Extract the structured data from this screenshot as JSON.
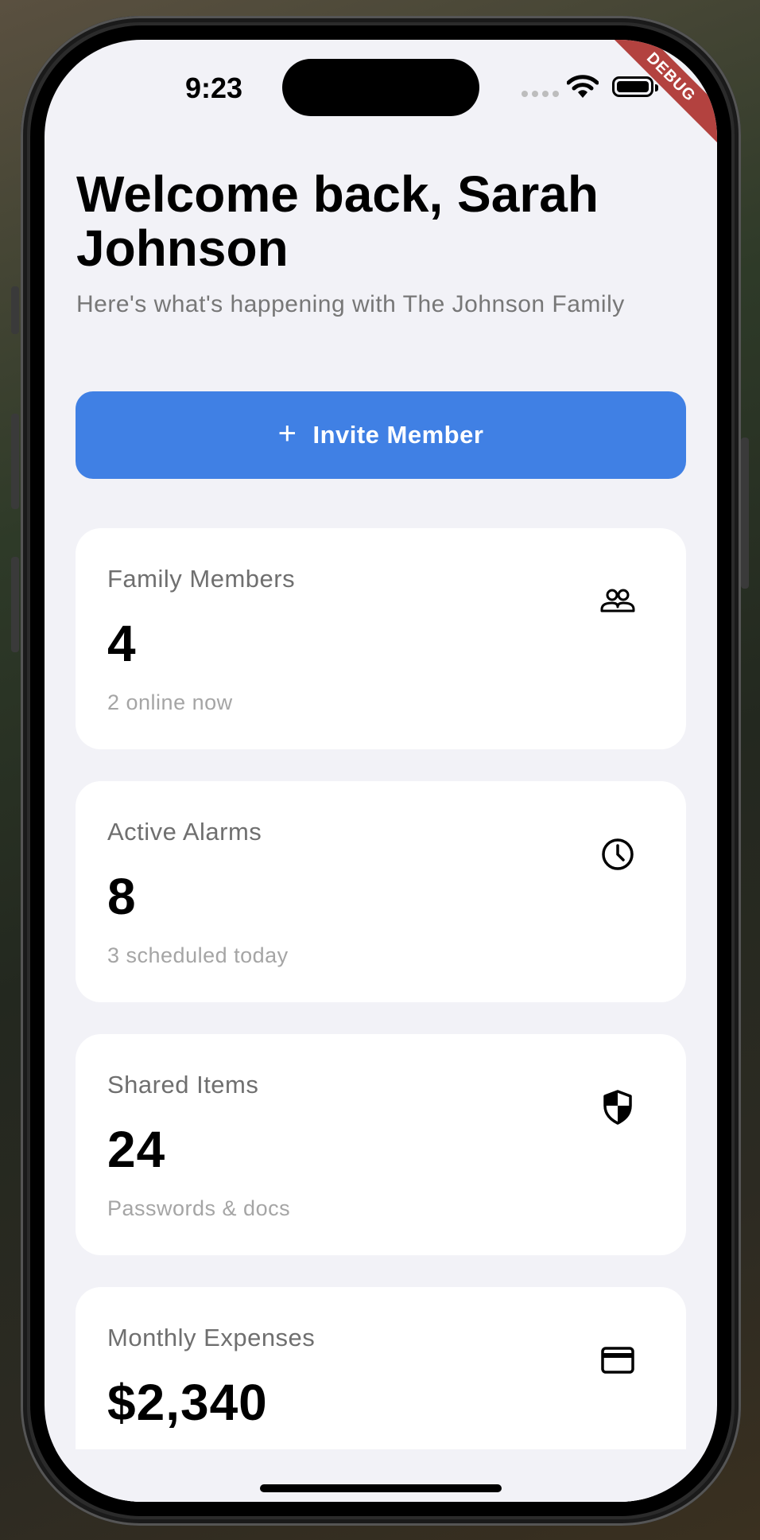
{
  "status_bar": {
    "time": "9:23"
  },
  "debug_banner": "DEBUG",
  "header": {
    "title": "Welcome back, Sarah Johnson",
    "subtitle": "Here's what's happening with The Johnson Family"
  },
  "invite_button": {
    "label": "Invite Member",
    "icon": "plus-icon"
  },
  "cards": [
    {
      "label": "Family Members",
      "value": "4",
      "sub": "2 online now",
      "icon": "people-icon"
    },
    {
      "label": "Active Alarms",
      "value": "8",
      "sub": "3 scheduled today",
      "icon": "clock-icon"
    },
    {
      "label": "Shared Items",
      "value": "24",
      "sub": "Passwords & docs",
      "icon": "shield-icon"
    },
    {
      "label": "Monthly Expenses",
      "value": "$2,340",
      "sub": "",
      "icon": "credit-card-icon"
    }
  ],
  "colors": {
    "accent": "#4080e4",
    "background": "#f2f2f7",
    "card": "#ffffff",
    "debug": "#b3423f"
  }
}
